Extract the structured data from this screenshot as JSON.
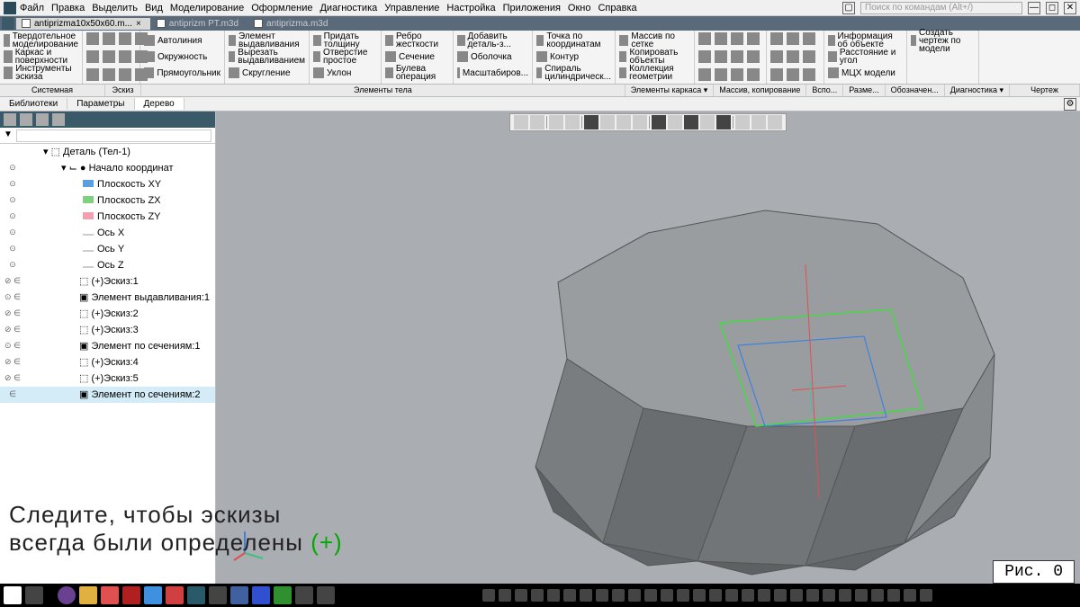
{
  "menubar": [
    "Файл",
    "Правка",
    "Выделить",
    "Вид",
    "Моделирование",
    "Оформление",
    "Диагностика",
    "Управление",
    "Настройка",
    "Приложения",
    "Окно",
    "Справка"
  ],
  "search_placeholder": "Поиск по командам (Alt+/)",
  "doc_tabs": [
    {
      "label": "antiprizma10x50x60.m...",
      "active": true
    },
    {
      "label": "antiprizm PT.m3d",
      "active": false
    },
    {
      "label": "antiprizma.m3d",
      "active": false
    }
  ],
  "ribbon": {
    "mode": {
      "solid": "Твердотельное моделирование",
      "wire": "Каркас и поверхности",
      "sketch": "Инструменты эскиза"
    },
    "shapes": {
      "auto": "Автолиния",
      "circle": "Окружность",
      "rect": "Прямоугольник",
      "fillet": "Скругление"
    },
    "ops": {
      "extrude": "Элемент выдавливания",
      "cut": "Вырезать выдавливанием"
    },
    "ops2": {
      "thick": "Придать толщину",
      "hole": "Отверстие простое",
      "draft": "Уклон"
    },
    "ops3": {
      "rib": "Ребро жесткости",
      "sec": "Сечение",
      "bool": "Булева операция"
    },
    "ops4": {
      "add": "Добавить деталь-з...",
      "shell": "Оболочка",
      "scale": "Масштабиров..."
    },
    "ops5": {
      "pt": "Точка по координатам",
      "contour": "Контур",
      "spiral": "Спираль цилиндрическ..."
    },
    "ops6": {
      "array": "Массив по сетке",
      "copy": "Копировать объекты",
      "coll": "Коллекция геометрии"
    },
    "info": {
      "info": "Информация об объекте",
      "dist": "Расстояние и угол",
      "mcx": "МЦХ модели"
    },
    "draw": {
      "label": "Создать чертеж по модели"
    }
  },
  "panel_bar": [
    "Системная",
    "Эскиз",
    "Элементы тела",
    "Элементы каркаса ▾",
    "Массив, копирование",
    "Вспо...",
    "Разме...",
    "Обозначен...",
    "Диагностика ▾",
    "Чертеж"
  ],
  "sec_tabs": [
    "Библиотеки",
    "Параметры",
    "Дерево"
  ],
  "tree": {
    "root": "Деталь (Тел-1)",
    "origin": "Начало координат",
    "planes": [
      "Плоскость XY",
      "Плоскость ZX",
      "Плоскость ZY"
    ],
    "axes": [
      "Ось X",
      "Ось Y",
      "Ось Z"
    ],
    "features": [
      {
        "label": "(+)Эскиз:1",
        "vis": "⊘ ∈"
      },
      {
        "label": "Элемент выдавливания:1",
        "vis": "⊙ ∈"
      },
      {
        "label": "(+)Эскиз:2",
        "vis": "⊘ ∈"
      },
      {
        "label": "(+)Эскиз:3",
        "vis": "⊘ ∈"
      },
      {
        "label": "Элемент по сечениям:1",
        "vis": "⊙ ∈"
      },
      {
        "label": "(+)Эскиз:4",
        "vis": "⊘ ∈"
      },
      {
        "label": "(+)Эскиз:5",
        "vis": "⊘ ∈"
      },
      {
        "label": "Элемент по сечениям:2",
        "vis": "  ∈",
        "selected": true
      }
    ]
  },
  "caption_line1": "Следите, чтобы эскизы",
  "caption_line2": "всегда были определены ",
  "caption_plus": "(+)",
  "fig_label": "Рис. 0"
}
